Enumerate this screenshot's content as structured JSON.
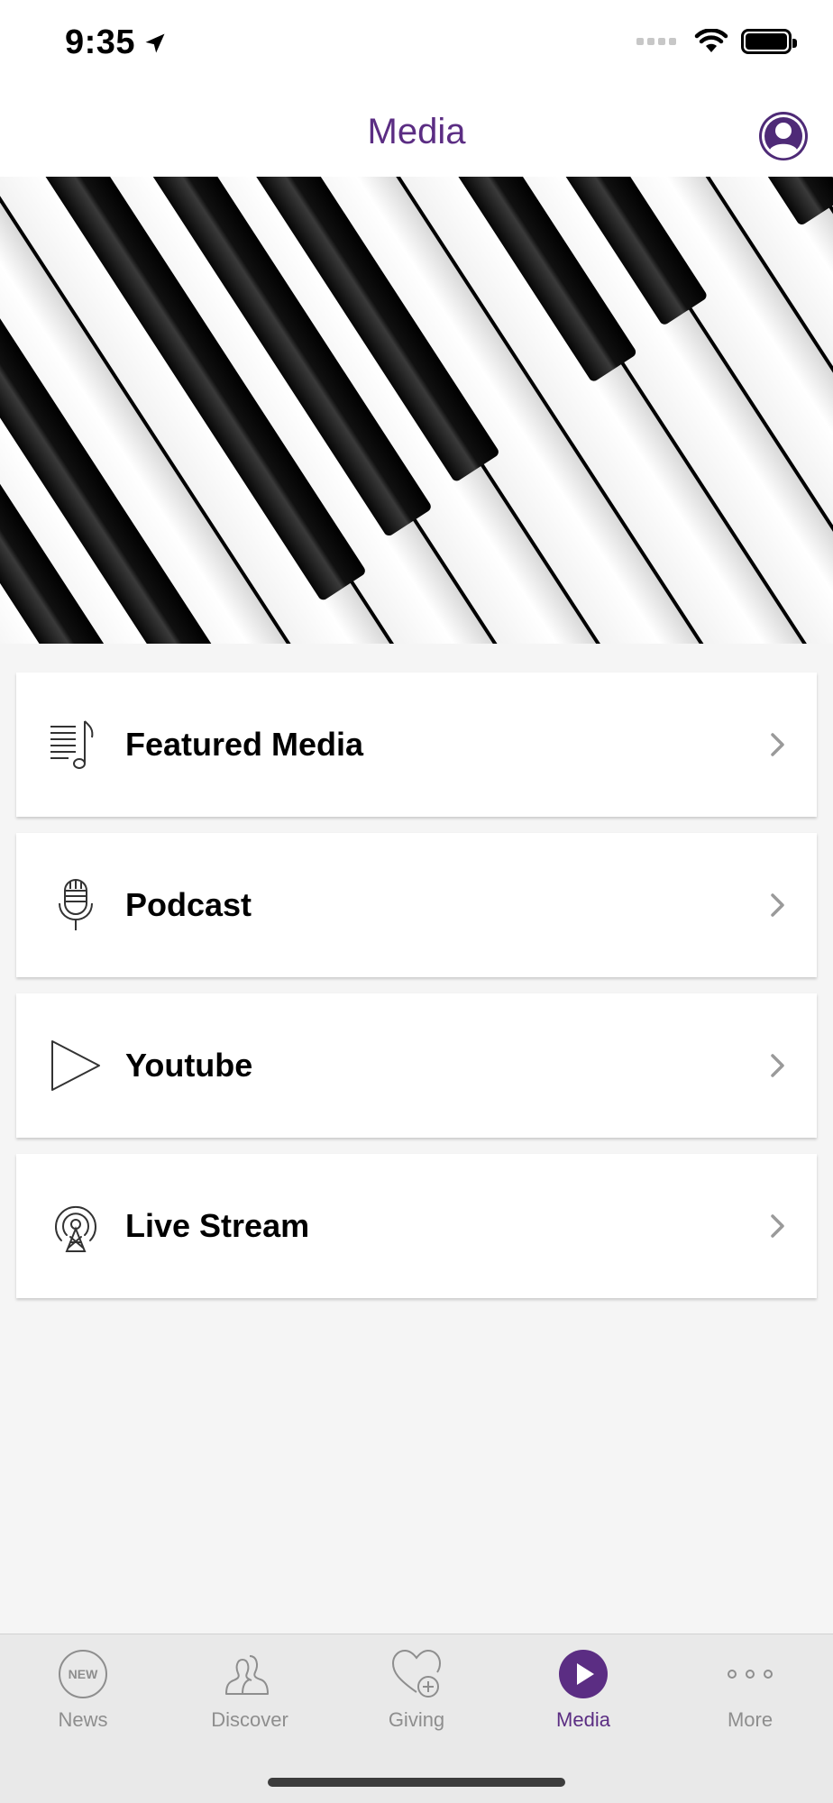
{
  "status_bar": {
    "time": "9:35"
  },
  "header": {
    "title": "Media"
  },
  "menu": {
    "items": [
      {
        "label": "Featured Media",
        "icon": "music-list-icon"
      },
      {
        "label": "Podcast",
        "icon": "microphone-icon"
      },
      {
        "label": "Youtube",
        "icon": "play-icon"
      },
      {
        "label": "Live Stream",
        "icon": "broadcast-icon"
      }
    ]
  },
  "tab_bar": {
    "tabs": [
      {
        "label": "News",
        "icon": "news-icon",
        "badge": "NEW"
      },
      {
        "label": "Discover",
        "icon": "people-icon"
      },
      {
        "label": "Giving",
        "icon": "heart-plus-icon"
      },
      {
        "label": "Media",
        "icon": "play-circle-icon",
        "active": true
      },
      {
        "label": "More",
        "icon": "more-dots-icon"
      }
    ]
  },
  "colors": {
    "accent": "#5b2d83",
    "inactive": "#8e8e8e",
    "background": "#f5f5f5"
  }
}
